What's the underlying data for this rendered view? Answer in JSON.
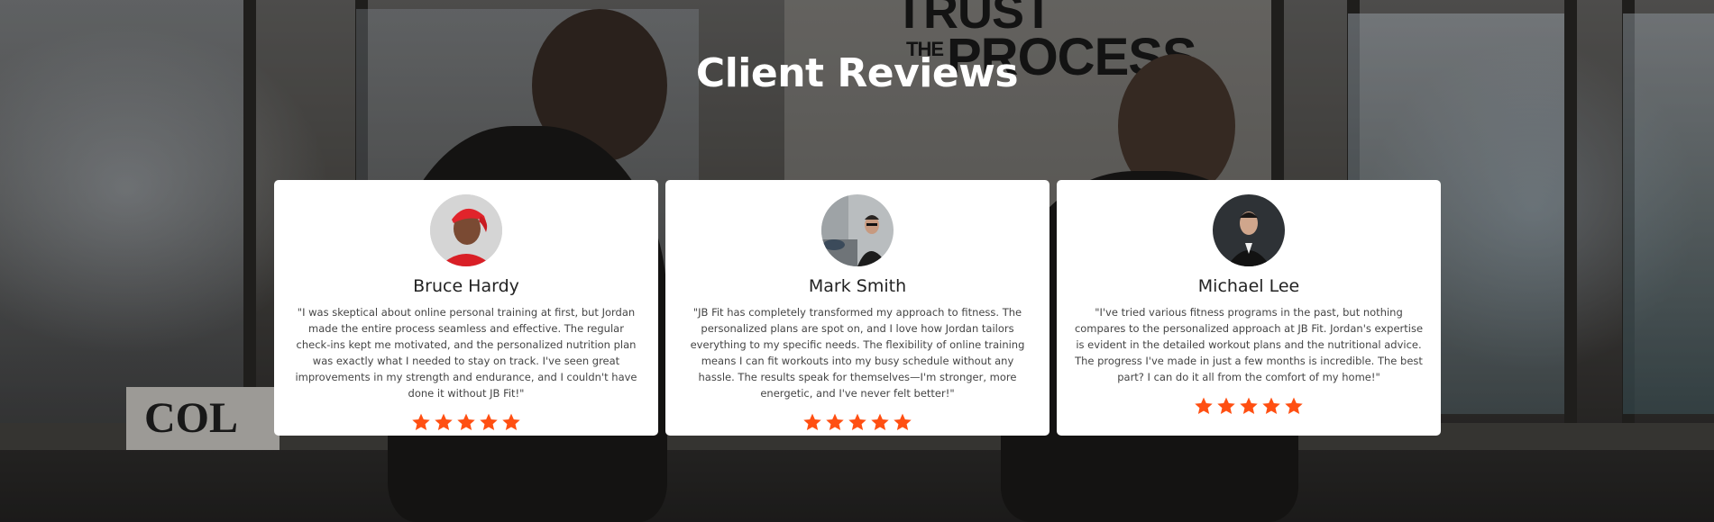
{
  "section": {
    "title": "Client Reviews"
  },
  "background": {
    "poster_line1": "TRUST",
    "poster_line2_small": "THE",
    "poster_line2": "PROCESS",
    "sign_text": "COL"
  },
  "colors": {
    "star": "#ff4f12",
    "card_bg": "#ffffff",
    "title": "#ffffff"
  },
  "reviews": [
    {
      "name": "Bruce Hardy",
      "quote": "\"I was skeptical about online personal training at first, but Jordan made the entire process seamless and effective. The regular check-ins kept me motivated, and the personalized nutrition plan was exactly what I needed to stay on track. I've seen great improvements in my strength and endurance, and I couldn't have done it without JB Fit!\"",
      "rating": 5
    },
    {
      "name": "Mark Smith",
      "quote": "\"JB Fit has completely transformed my approach to fitness. The personalized plans are spot on, and I love how Jordan tailors everything to my specific needs. The flexibility of online training means I can fit workouts into my busy schedule without any hassle. The results speak for themselves—I'm stronger, more energetic, and I've never felt better!\"",
      "rating": 5
    },
    {
      "name": "Michael Lee",
      "quote": "\"I've tried various fitness programs in the past, but nothing compares to the personalized approach at JB Fit. Jordan's expertise is evident in the detailed workout plans and the nutritional advice. The progress I've made in just a few months is incredible. The best part? I can do it all from the comfort of my home!\"",
      "rating": 5
    }
  ]
}
